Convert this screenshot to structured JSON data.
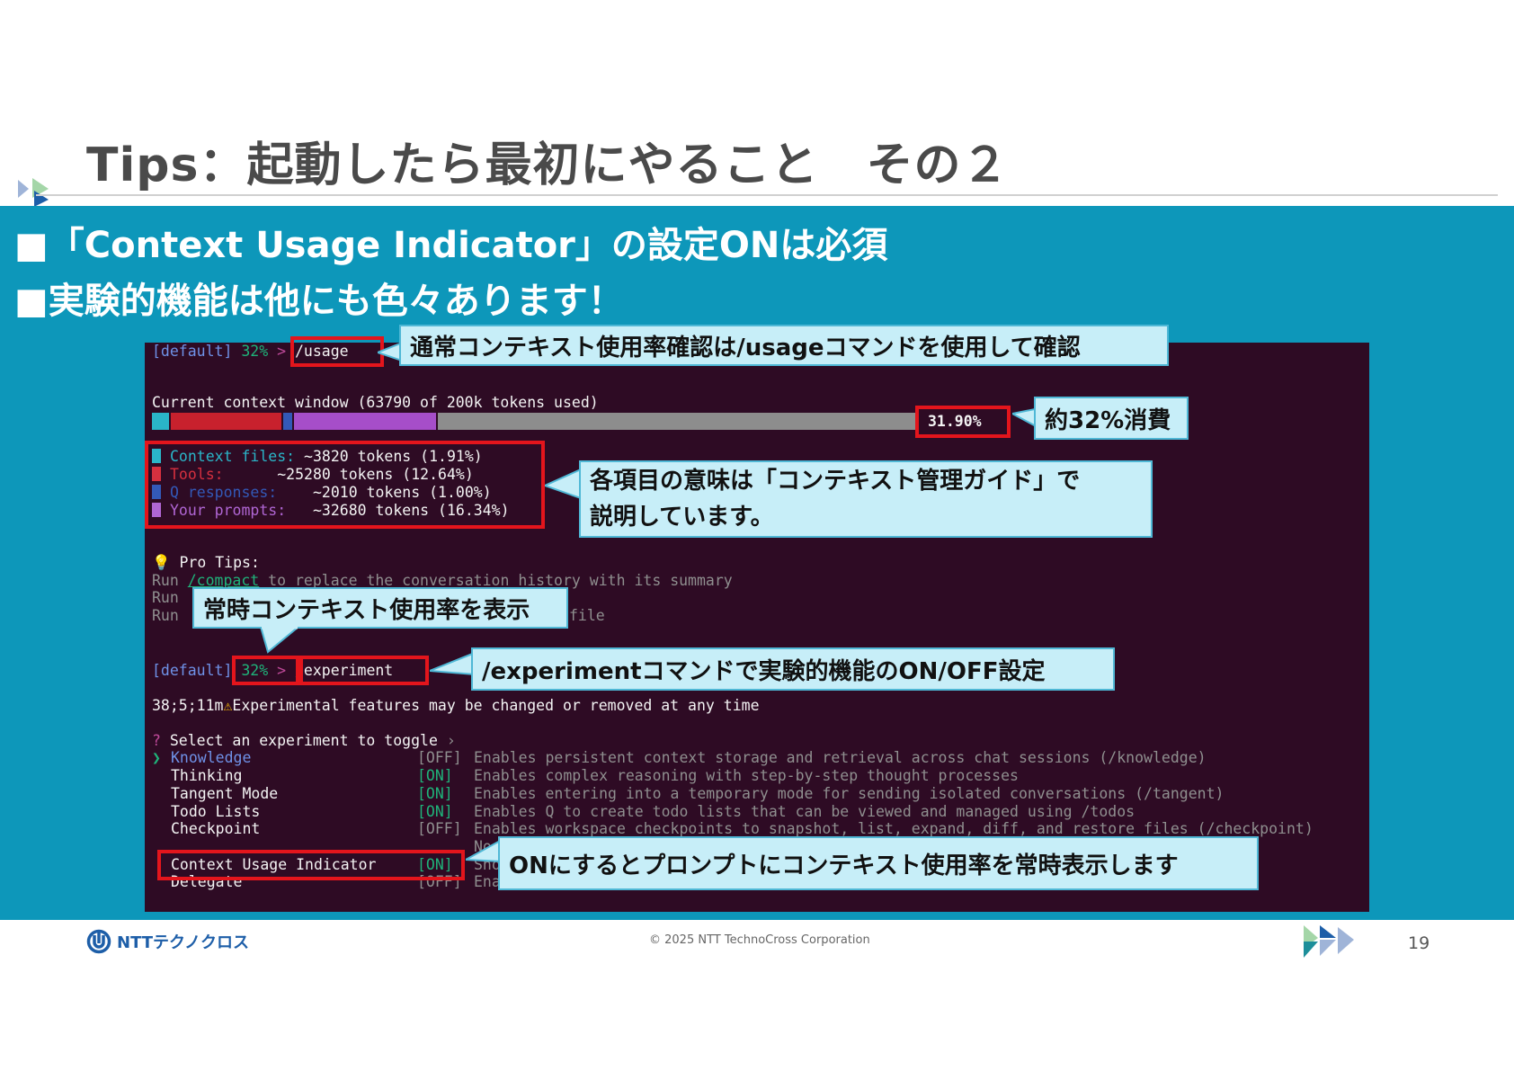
{
  "slide": {
    "title": "Tips：起動したら最初にやること　その２",
    "bullets": [
      "■「Context Usage Indicator」の設定ONは必須",
      "■実験的機能は他にも色々あります！"
    ],
    "page_number": "19"
  },
  "terminal": {
    "prompt1": {
      "label": "[default]",
      "percent": "32%",
      "arrow": ">",
      "command": "/usage"
    },
    "context_window_line": "Current context window (63790 of 200k tokens used)",
    "usage_bar": {
      "percent_text": "31.90%",
      "segments_fraction": {
        "context_files": 0.0191,
        "tools": 0.1264,
        "q_responses": 0.01,
        "your_prompts": 0.1634
      }
    },
    "breakdown": [
      {
        "label": "Context files:",
        "value": "~3820 tokens (1.91%)",
        "color": "#2ab5c8"
      },
      {
        "label": "Tools:",
        "value": "~25280 tokens (12.64%)",
        "color": "#d6303f"
      },
      {
        "label": "Q responses:",
        "value": "~2010 tokens (1.00%)",
        "color": "#3359b8"
      },
      {
        "label": "Your prompts:",
        "value": "~32680 tokens (16.34%)",
        "color": "#b066d4"
      }
    ],
    "pro_tips_title": "💡 Pro Tips:",
    "pro_tips": [
      {
        "run": "Run",
        "cmd": "/compact",
        "rest": " to replace the conversation history with its summary"
      },
      {
        "run": "Run",
        "cmd": "",
        "rest": ""
      },
      {
        "run": "Run",
        "cmd": "",
        "rest": "file"
      }
    ],
    "prompt2": {
      "label": "[default]",
      "percent": "32%",
      "arrow": ">",
      "command": "/experiment"
    },
    "warning_line_prefix": "38;5;11m",
    "warning_icon": "⚠",
    "warning_line": "Experimental features may be changed or removed at any time",
    "select_prompt_mark": "?",
    "select_prompt": "Select an experiment to toggle",
    "select_prompt_chevron": "›",
    "selected_marker": "❯",
    "experiments": [
      {
        "name": "Knowledge",
        "state": "[OFF]",
        "desc": "Enables persistent context storage and retrieval across chat sessions (/knowledge)"
      },
      {
        "name": "Thinking",
        "state": "[ON]",
        "desc": "Enables complex reasoning with step-by-step thought processes"
      },
      {
        "name": "Tangent Mode",
        "state": "[ON]",
        "desc": "Enables entering into a temporary mode for sending isolated conversations (/tangent)"
      },
      {
        "name": "Todo Lists",
        "state": "[ON]",
        "desc": "Enables Q to create todo lists that can be viewed and managed using /todos"
      },
      {
        "name": "Checkpoint",
        "state": "[OFF]",
        "desc": "Enables workspace checkpoints to snapshot, list, expand, diff, and restore files (/checkpoint)"
      },
      {
        "name": "",
        "state": "",
        "desc": "No"
      },
      {
        "name": "Context Usage Indicator",
        "state": "[ON]",
        "desc": "Sho"
      },
      {
        "name": "Delegate",
        "state": "[OFF]",
        "desc": "Ena"
      }
    ]
  },
  "callouts": {
    "usage": "通常コンテキスト使用率確認は/usageコマンドを使用して確認",
    "percent": "約32%消費",
    "breakdown_line1": "各項目の意味は「コンテキスト管理ガイド」で",
    "breakdown_line2": "説明しています。",
    "always_show": "常時コンテキスト使用率を表示",
    "experiment": "/experimentコマンドで実験的機能のON/OFF設定",
    "indicator": "ONにするとプロンプトにコンテキスト使用率を常時表示します"
  },
  "footer": {
    "logo_text": "NTTテクノクロス",
    "copyright": "© 2025 NTT TechnoCross Corporation"
  },
  "colors": {
    "band": "#0d97ba",
    "terminal_bg": "#2e0b24",
    "highlight": "#e3151c",
    "callout_bg": "#c7eef8"
  }
}
